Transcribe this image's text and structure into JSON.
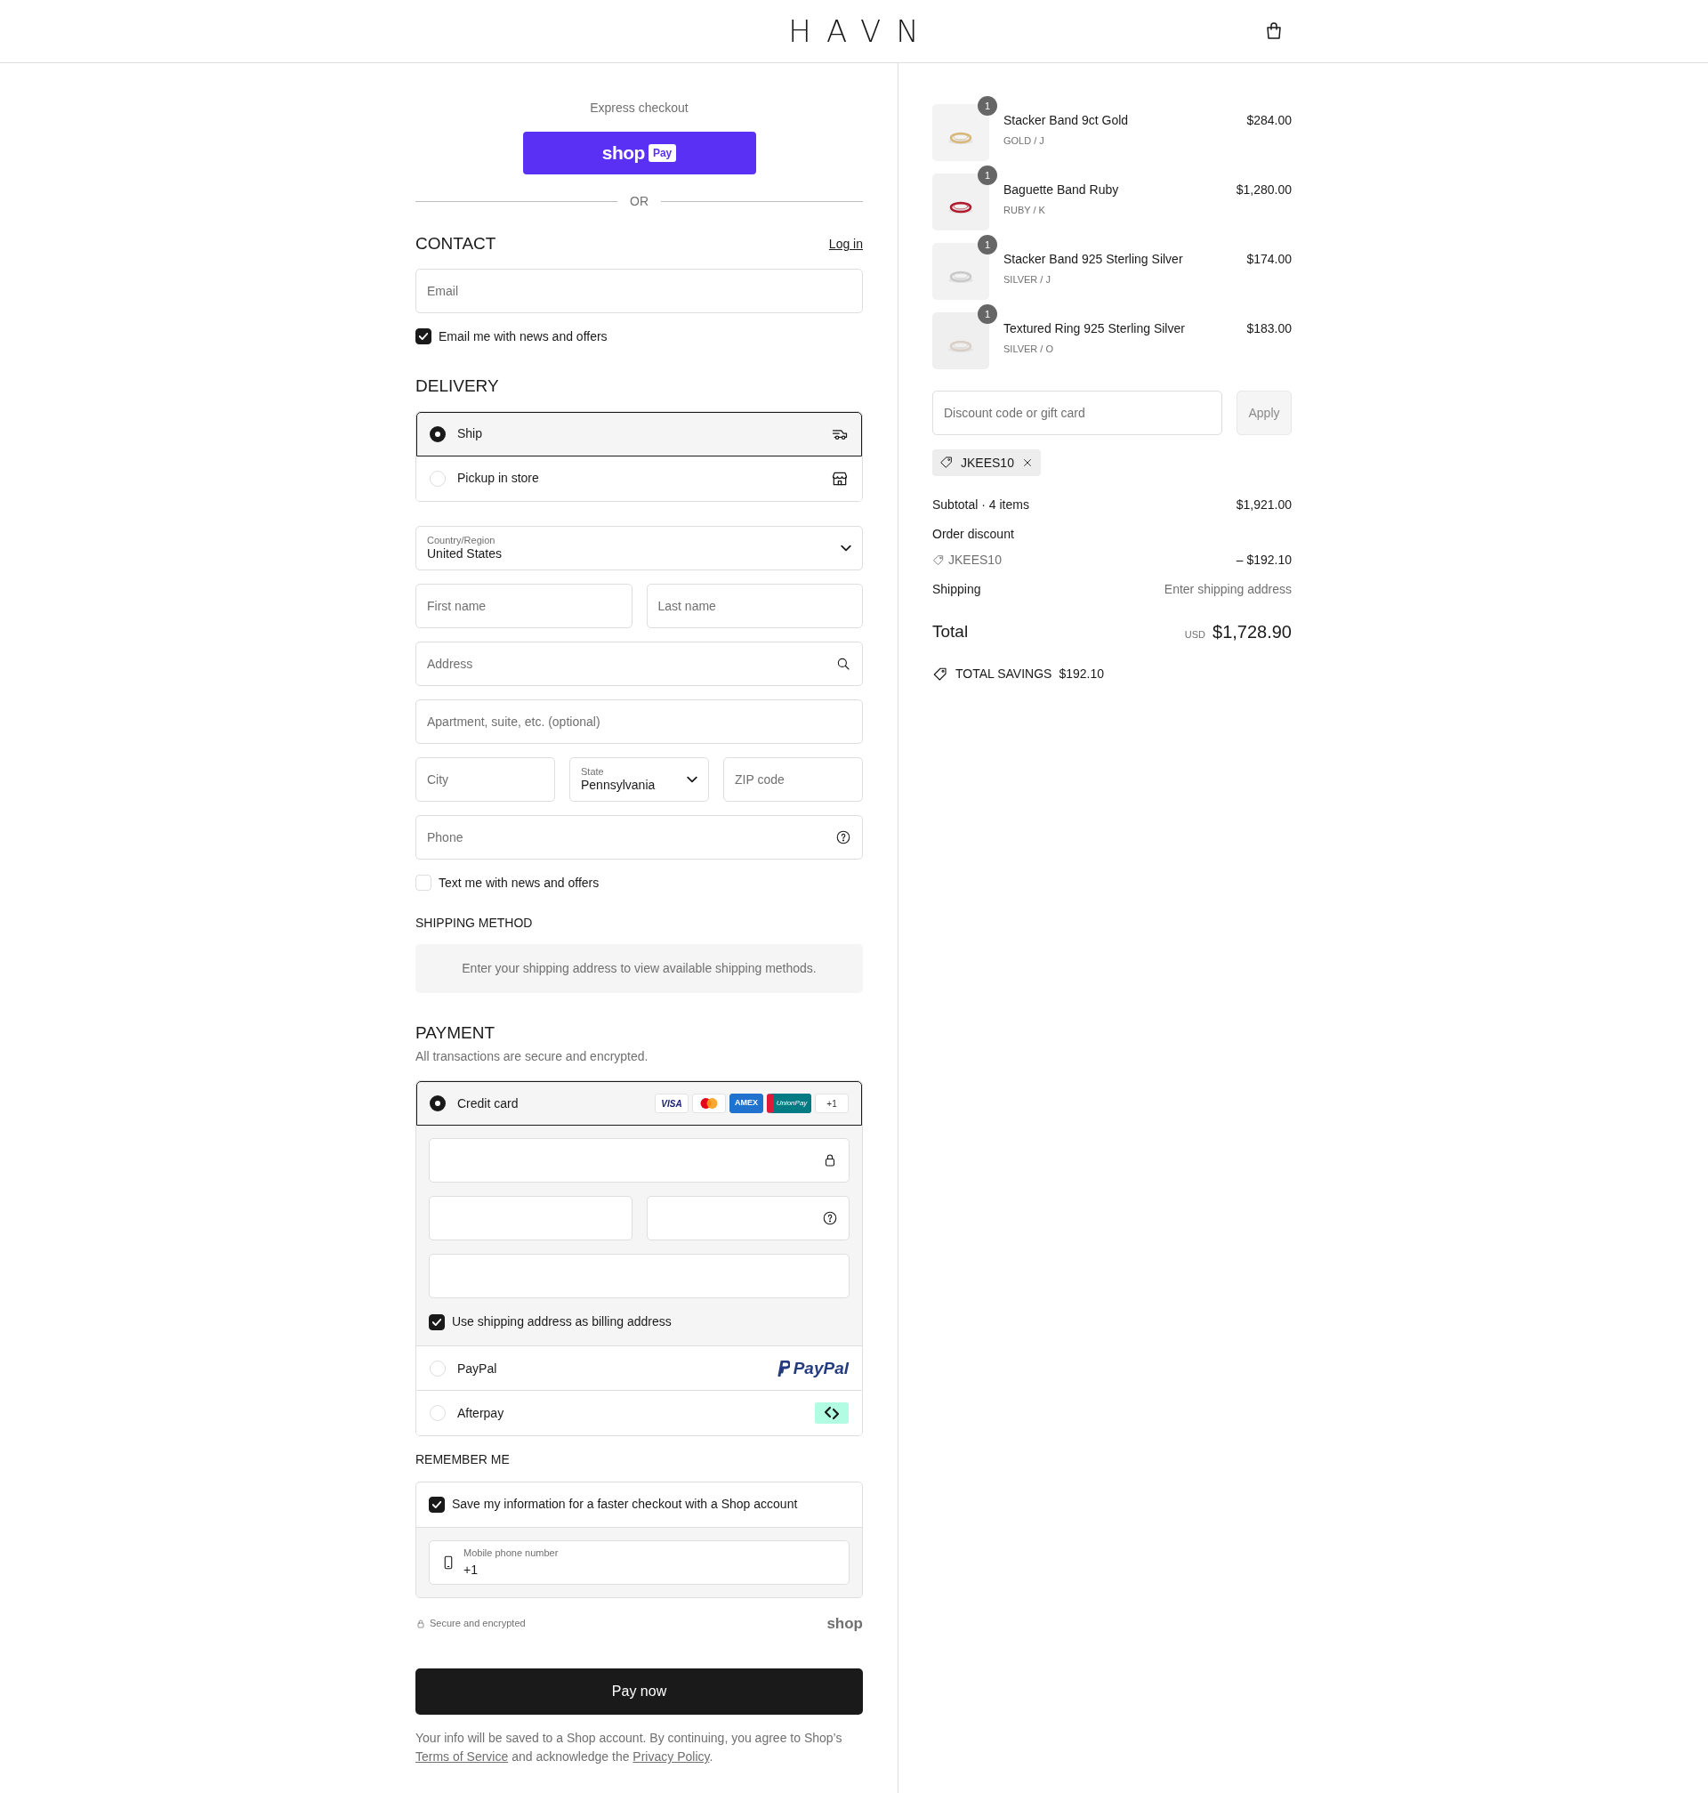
{
  "header": {
    "logo": "HAVN"
  },
  "express": {
    "label": "Express checkout",
    "button_text": "shop",
    "button_badge": "Pay",
    "divider": "OR"
  },
  "contact": {
    "heading": "CONTACT",
    "link": "Log in",
    "email": {
      "placeholder": "Email"
    },
    "newsletter": {
      "label": "Email me with news and offers",
      "checked": true
    }
  },
  "delivery": {
    "heading": "DELIVERY",
    "options": [
      {
        "kind": "ship",
        "label": "Ship",
        "selected": true
      },
      {
        "kind": "pickup",
        "label": "Pickup in store",
        "selected": false
      }
    ],
    "rows": [
      [
        {
          "kind": "select",
          "label": "Country/Region",
          "value": "United States"
        }
      ],
      [
        {
          "kind": "text",
          "placeholder": "First name"
        },
        {
          "kind": "text",
          "placeholder": "Last name"
        }
      ],
      [
        {
          "kind": "search",
          "placeholder": "Address"
        }
      ],
      [
        {
          "kind": "text",
          "placeholder": "Apartment, suite, etc. (optional)"
        }
      ],
      [
        {
          "kind": "text",
          "placeholder": "City"
        },
        {
          "kind": "select",
          "label": "State",
          "value": "Pennsylvania"
        },
        {
          "kind": "text",
          "placeholder": "ZIP code"
        }
      ],
      [
        {
          "kind": "help",
          "placeholder": "Phone"
        }
      ]
    ],
    "sms": {
      "label": "Text me with news and offers",
      "checked": false
    }
  },
  "shipping_method": {
    "heading": "SHIPPING METHOD",
    "message": "Enter your shipping address to view available shipping methods."
  },
  "payment": {
    "heading": "PAYMENT",
    "subtitle": "All transactions are secure and encrypted.",
    "methods": [
      {
        "kind": "card",
        "label": "Credit card",
        "selected": true,
        "brands": [
          {
            "kind": "visa",
            "text": "VISA"
          },
          {
            "kind": "mastercard"
          },
          {
            "kind": "amex",
            "text": "AMEX"
          },
          {
            "kind": "unionpay",
            "text": "UnionPay"
          }
        ],
        "more": "+1",
        "field_rows": [
          [
            {
              "kind": "lock"
            }
          ],
          [
            {
              "kind": "plain"
            },
            {
              "kind": "help"
            }
          ],
          [
            {
              "kind": "plain"
            }
          ]
        ],
        "billing": {
          "label": "Use shipping address as billing address",
          "checked": true
        }
      },
      {
        "kind": "paypal",
        "label": "PayPal",
        "selected": false,
        "logo": "PayPal"
      },
      {
        "kind": "afterpay",
        "label": "Afterpay",
        "selected": false
      }
    ]
  },
  "remember": {
    "heading": "REMEMBER ME",
    "save": {
      "label": "Save my information for a faster checkout with a Shop account",
      "checked": true
    },
    "phone": {
      "label": "Mobile phone number",
      "value": "+1"
    }
  },
  "secure_note": "Secure and encrypted",
  "shop_logo": "shop",
  "pay_button": "Pay now",
  "legal": [
    {
      "text": "Your info will be saved to a Shop account. By continuing, you agree to Shop’s "
    },
    {
      "link": "Terms of Service"
    },
    {
      "text": " and acknowledge the "
    },
    {
      "link": "Privacy Policy"
    },
    {
      "text": "."
    }
  ],
  "summary": {
    "items": [
      {
        "name": "Stacker Band 9ct Gold",
        "variant": "GOLD / J",
        "price": "$284.00",
        "quantity": "1"
      },
      {
        "name": "Baguette Band Ruby",
        "variant": "RUBY / K",
        "price": "$1,280.00",
        "quantity": "1"
      },
      {
        "name": "Stacker Band 925 Sterling Silver",
        "variant": "SILVER / J",
        "price": "$174.00",
        "quantity": "1"
      },
      {
        "name": "Textured Ring 925 Sterling Silver",
        "variant": "SILVER / O",
        "price": "$183.00",
        "quantity": "1"
      }
    ],
    "discount": {
      "placeholder": "Discount code or gift card",
      "button": "Apply"
    },
    "applied_code": "JKEES10",
    "lines": [
      {
        "kind": "subtotal",
        "label": "Subtotal · 4 items",
        "value": "$1,921.00"
      },
      {
        "kind": "discount",
        "label": "Order discount",
        "code": "JKEES10",
        "value": "– $192.10"
      },
      {
        "kind": "shipping",
        "label": "Shipping",
        "value": "Enter shipping address"
      }
    ],
    "total": {
      "label": "Total",
      "currency": "USD",
      "value": "$1,728.90"
    },
    "savings": {
      "label": "TOTAL SAVINGS",
      "value": "$192.10"
    }
  }
}
